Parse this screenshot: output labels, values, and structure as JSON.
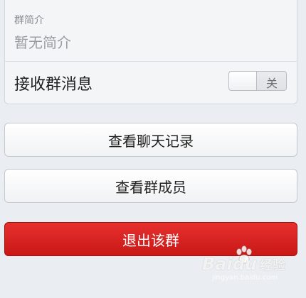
{
  "group_info": {
    "intro_label": "群简介",
    "intro_value": "暂无简介",
    "receive_label": "接收群消息",
    "receive_toggle_state": "关"
  },
  "actions": {
    "view_history_label": "查看聊天记录",
    "view_members_label": "查看群成员",
    "exit_group_label": "退出该群"
  },
  "watermark": {
    "brand": "Bai",
    "brand_suffix": "经验",
    "url": "jingyan.baidu.com"
  },
  "colors": {
    "background": "#eaedf1",
    "exit_button": "#d7201e",
    "card": "#f4f5f7"
  }
}
